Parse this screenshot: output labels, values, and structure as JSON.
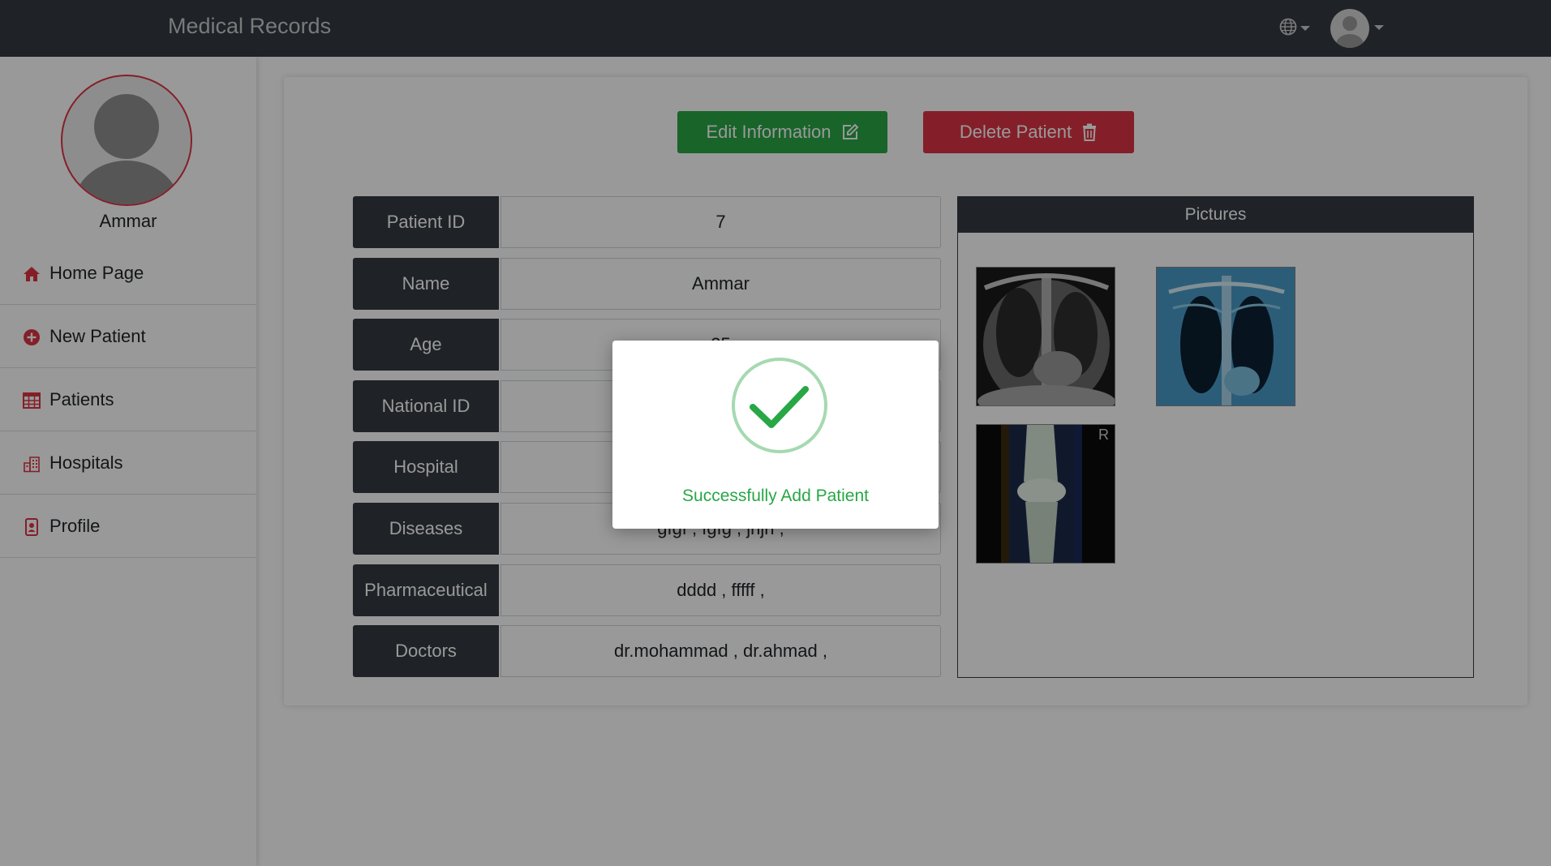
{
  "app": {
    "title": "Medical Records"
  },
  "header": {
    "language_icon": "globe-icon",
    "user_icon": "user-avatar-icon"
  },
  "sidebar": {
    "user_name": "Ammar",
    "items": [
      {
        "label": "Home Page",
        "icon": "home-icon"
      },
      {
        "label": "New Patient",
        "icon": "plus-circle-icon"
      },
      {
        "label": "Patients",
        "icon": "table-icon"
      },
      {
        "label": "Hospitals",
        "icon": "hospital-icon"
      },
      {
        "label": "Profile",
        "icon": "id-badge-icon"
      }
    ]
  },
  "actions": {
    "edit_label": "Edit Information",
    "delete_label": "Delete Patient"
  },
  "patient": {
    "fields": [
      {
        "label": "Patient ID",
        "value": "7"
      },
      {
        "label": "Name",
        "value": "Ammar"
      },
      {
        "label": "Age",
        "value": "25"
      },
      {
        "label": "National ID",
        "value": ""
      },
      {
        "label": "Hospital",
        "value": ""
      },
      {
        "label": "Diseases",
        "value": "gfgf , fgfg , jhjh ,"
      },
      {
        "label": "Pharmaceutical",
        "value": "dddd , fffff ,"
      },
      {
        "label": "Doctors",
        "value": "dr.mohammad , dr.ahmad ,"
      }
    ]
  },
  "pictures": {
    "header": "Pictures",
    "items": [
      "chest-xray-grayscale",
      "chest-xray-blue",
      "knee-xray"
    ],
    "marker": "R"
  },
  "modal": {
    "icon": "check-circle-icon",
    "message": "Successfully Add Patient"
  },
  "colors": {
    "navbar": "#343a40",
    "success": "#28a745",
    "danger": "#dc3545",
    "label_bg": "#343a40"
  }
}
